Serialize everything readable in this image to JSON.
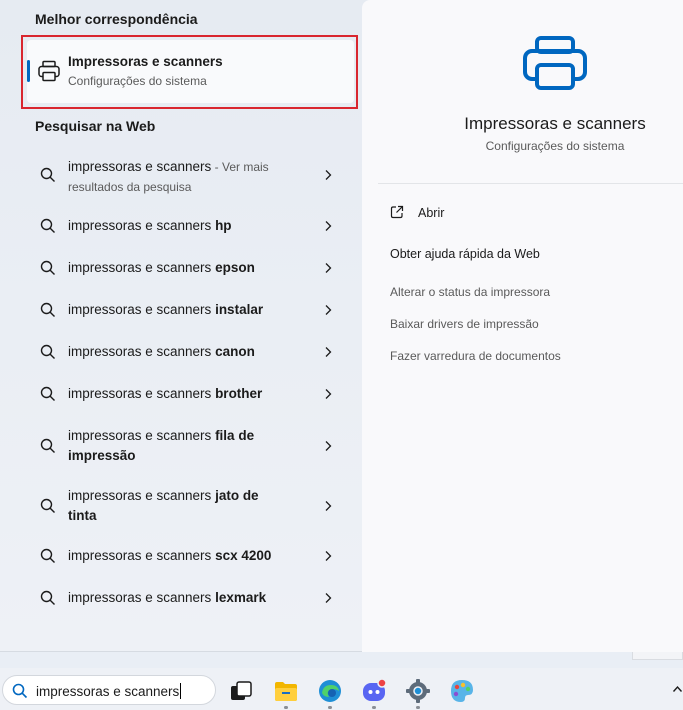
{
  "best_match": {
    "section_title": "Melhor correspondência",
    "title": "Impressoras e scanners",
    "subtitle": "Configurações do sistema"
  },
  "web": {
    "section_title": "Pesquisar na Web",
    "items": [
      {
        "base": "impressoras e scanners",
        "suffix": "",
        "more": " - Ver mais resultados da pesquisa"
      },
      {
        "base": "impressoras e scanners ",
        "suffix": "hp",
        "more": ""
      },
      {
        "base": "impressoras e scanners ",
        "suffix": "epson",
        "more": ""
      },
      {
        "base": "impressoras e scanners ",
        "suffix": "instalar",
        "more": ""
      },
      {
        "base": "impressoras e scanners ",
        "suffix": "canon",
        "more": ""
      },
      {
        "base": "impressoras e scanners ",
        "suffix": "brother",
        "more": ""
      },
      {
        "base": "impressoras e scanners ",
        "suffix": "fila de impressão",
        "more": ""
      },
      {
        "base": "impressoras e scanners ",
        "suffix": "jato de tinta",
        "more": ""
      },
      {
        "base": "impressoras e scanners ",
        "suffix": "scx 4200",
        "more": ""
      },
      {
        "base": "impressoras e scanners ",
        "suffix": "lexmark",
        "more": ""
      }
    ]
  },
  "detail": {
    "title": "Impressoras e scanners",
    "subtitle": "Configurações do sistema",
    "open_label": "Abrir",
    "help_title": "Obter ajuda rápida da Web",
    "help_links": [
      "Alterar o status da impressora",
      "Baixar drivers de impressão",
      "Fazer varredura de documentos"
    ]
  },
  "taskbar": {
    "search_value": "impressoras e scanners",
    "apps": [
      "task-view-icon",
      "file-explorer-icon",
      "edge-icon",
      "discord-icon",
      "settings-icon",
      "paint-icon"
    ]
  },
  "colors": {
    "accent": "#0067c0",
    "highlight_border": "#d9262f"
  }
}
